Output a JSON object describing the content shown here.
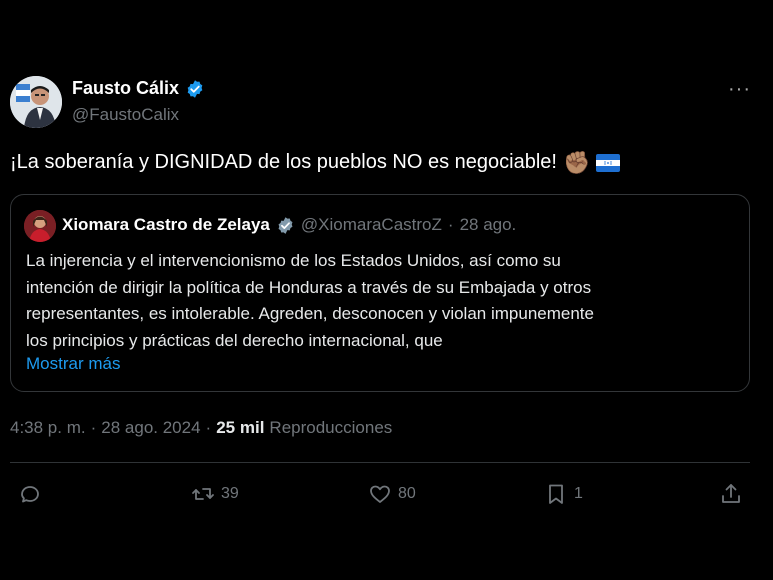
{
  "author": {
    "name": "Fausto Cálix",
    "handle": "@FaustoCalix",
    "more_label": "···"
  },
  "tweet": {
    "text": "¡La soberanía y DIGNIDAD de los pueblos NO es negociable!",
    "emoji_fist": "✊🏽",
    "flag_icon": "honduras-flag-icon"
  },
  "quote": {
    "name": "Xiomara Castro de Zelaya",
    "handle": "@XiomaraCastroZ",
    "separator": "·",
    "date": "28 ago.",
    "lines": [
      "La injerencia y el intervencionismo de los Estados Unidos, así como su",
      "intención de dirigir la política de Honduras a través de su Embajada y otros",
      "representantes, es intolerable. Agreden, desconocen y violan impunemente",
      "los principios y prácticas del derecho internacional, que"
    ],
    "show_more": "Mostrar más"
  },
  "meta": {
    "time": "4:38 p. m.",
    "sep1": "·",
    "date": "28 ago. 2024",
    "sep2": "·",
    "views": "25 mil",
    "views_label": "Reproducciones"
  },
  "actions": {
    "reply_count": "",
    "retweet_count": "39",
    "like_count": "80",
    "bookmark_count": "1"
  },
  "colors": {
    "background": "#000000",
    "accent": "#1d9bf0",
    "muted": "#71767b",
    "verified": "#1d9bf0"
  }
}
